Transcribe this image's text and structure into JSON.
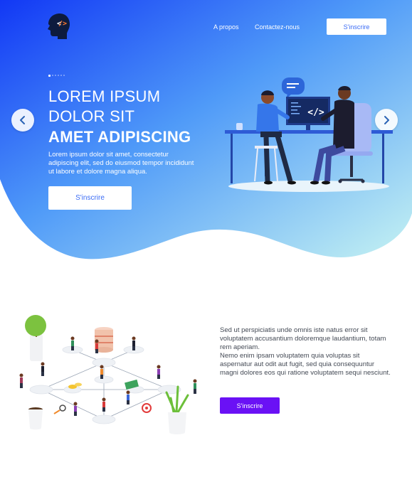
{
  "nav": {
    "about_label": "A propos",
    "contact_label": "Contactez-nous",
    "signup_label": "S'inscrire",
    "logo_icon": "code-brain-logo-icon"
  },
  "hero": {
    "title_line1": "LOREM IPSUM",
    "title_line2": "DOLOR SIT",
    "title_line3": "AMET ADIPISCING",
    "description": "Lorem ipsum dolor sit amet, consectetur adipiscing elit, sed do eiusmod tempor incididunt ut labore et dolore magna aliqua.",
    "cta_label": "S'inscrire",
    "slide_count": 6,
    "active_slide": 1,
    "prev_icon": "chevron-left-icon",
    "next_icon": "chevron-right-icon",
    "illustration": "developers-at-desk-illustration"
  },
  "section2": {
    "paragraph1": "Sed ut perspiciatis unde omnis iste natus error sit voluptatem accusantium doloremque laudantium, totam rem aperiam.",
    "paragraph2": "Nemo enim ipsam voluptatem quia voluptas sit aspernatur aut odit aut fugit, sed quia consequuntur magni dolores eos qui ratione voluptatem sequi nesciunt.",
    "cta_label": "S'inscrire",
    "illustration": "isometric-network-people-illustration"
  },
  "colors": {
    "hero_gradient_start": "#1c4cf7",
    "hero_gradient_end": "#bff0f3",
    "primary_text_blue": "#3b6cf5",
    "cta_purple": "#6a11f5",
    "body_text": "#444a55"
  }
}
